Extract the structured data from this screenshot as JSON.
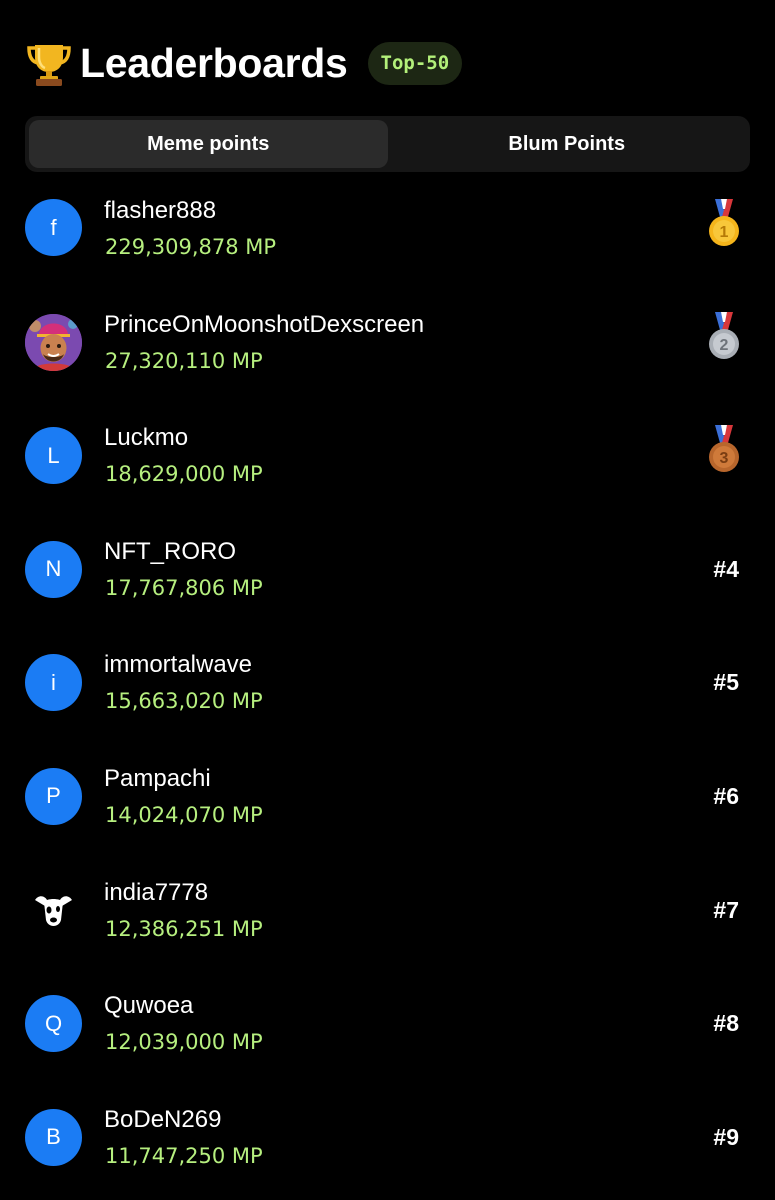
{
  "header": {
    "title": "Leaderboards",
    "badge": "Top-50",
    "icon": "trophy-icon"
  },
  "tabs": [
    {
      "label": "Meme points",
      "active": true
    },
    {
      "label": "Blum Points",
      "active": false
    }
  ],
  "colors": {
    "background": "#000000",
    "accent_green": "#b6ef7f",
    "avatar_blue": "#1b7cf4",
    "tab_bar": "#161616",
    "tab_active": "#2b2b2b"
  },
  "entries": [
    {
      "avatar": "f",
      "name": "flasher888",
      "score": "229,309,878 MP",
      "rank": "1",
      "medal": "gold-medal-icon"
    },
    {
      "avatar": "",
      "name": "PrinceOnMoonshotDexscreen",
      "score": "27,320,110 MP",
      "rank": "2",
      "medal": "silver-medal-icon"
    },
    {
      "avatar": "L",
      "name": "Luckmo",
      "score": "18,629,000 MP",
      "rank": "3",
      "medal": "bronze-medal-icon"
    },
    {
      "avatar": "N",
      "name": "NFT_RORO",
      "score": "17,767,806 MP",
      "rank": "#4"
    },
    {
      "avatar": "i",
      "name": "immortalwave",
      "score": "15,663,020 MP",
      "rank": "#5"
    },
    {
      "avatar": "P",
      "name": "Pampachi",
      "score": "14,024,070 MP",
      "rank": "#6"
    },
    {
      "avatar": "",
      "name": "india7778",
      "score": "12,386,251 MP",
      "rank": "#7"
    },
    {
      "avatar": "Q",
      "name": "Quwoea",
      "score": "12,039,000 MP",
      "rank": "#8"
    },
    {
      "avatar": "B",
      "name": "BoDeN269",
      "score": "11,747,250 MP",
      "rank": "#9"
    }
  ]
}
